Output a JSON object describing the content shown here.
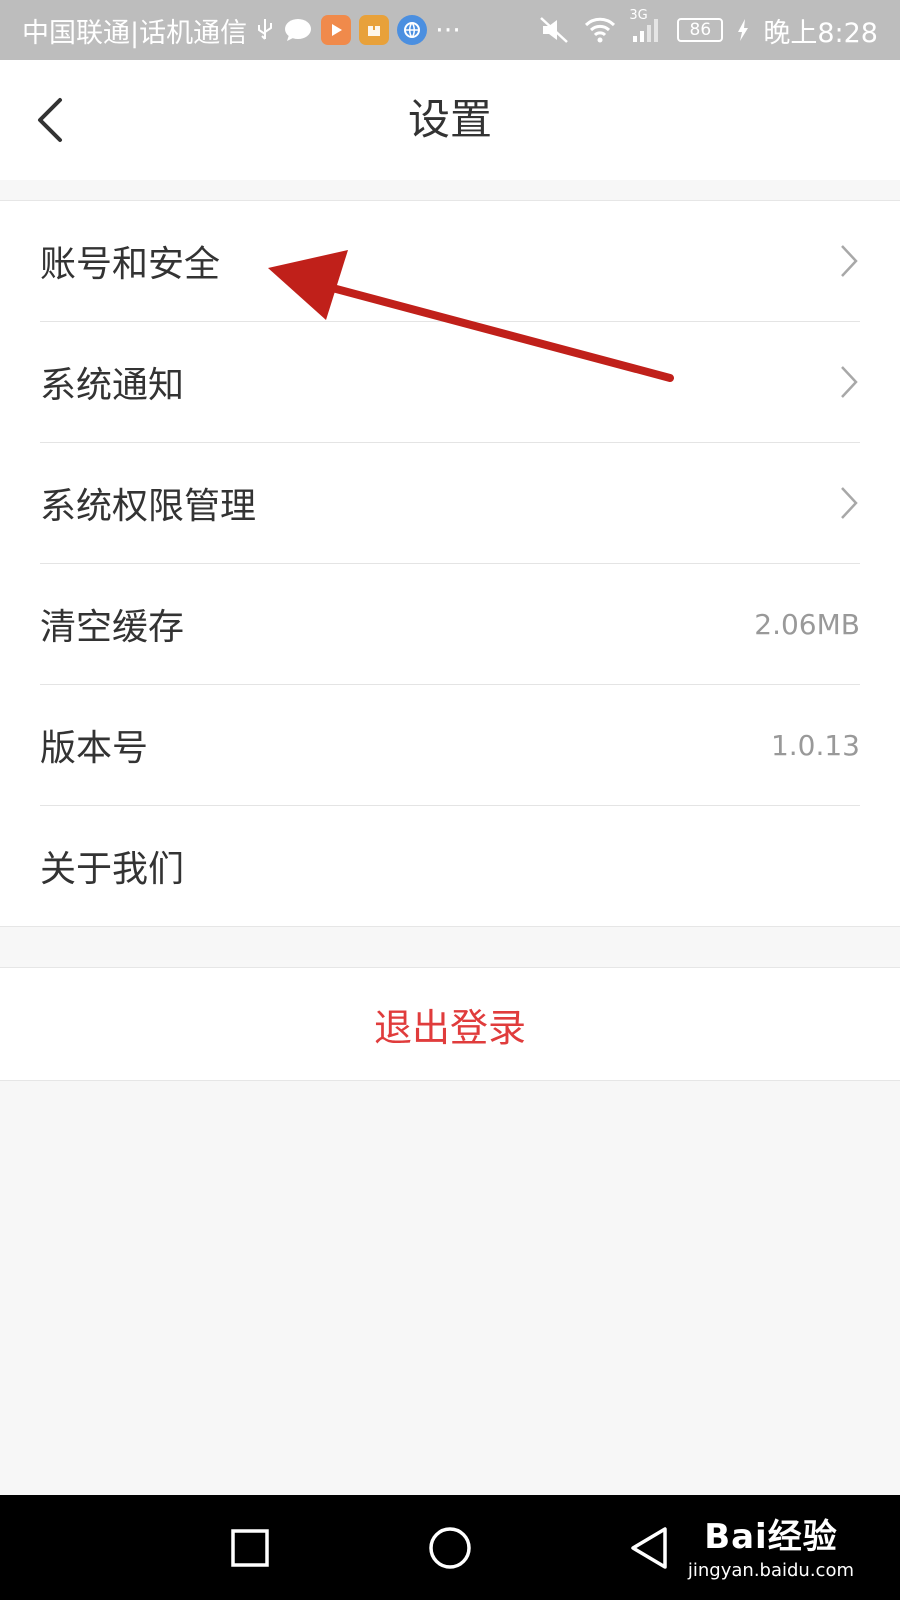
{
  "status_bar": {
    "carrier": "中国联通|话机通信",
    "signal": "3G",
    "battery": "86",
    "time": "晚上8:28",
    "more": "···"
  },
  "header": {
    "title": "设置"
  },
  "settings": [
    {
      "label": "账号和安全",
      "value": "",
      "has_chevron": true
    },
    {
      "label": "系统通知",
      "value": "",
      "has_chevron": true
    },
    {
      "label": "系统权限管理",
      "value": "",
      "has_chevron": true
    },
    {
      "label": "清空缓存",
      "value": "2.06MB",
      "has_chevron": false
    },
    {
      "label": "版本号",
      "value": "1.0.13",
      "has_chevron": false
    },
    {
      "label": "关于我们",
      "value": "",
      "has_chevron": false
    }
  ],
  "logout": {
    "label": "退出登录"
  },
  "watermark": {
    "logo": "Bai经验",
    "url": "jingyan.baidu.com"
  },
  "colors": {
    "status_bar_bg": "#bdbdbd",
    "logout_text": "#e03c3c",
    "annotation_arrow": "#c0201a"
  },
  "icons": {
    "back": "back-arrow-icon",
    "chevron": "chevron-right-icon",
    "nav_recents": "square-icon",
    "nav_home": "circle-icon",
    "nav_back": "triangle-back-icon"
  }
}
